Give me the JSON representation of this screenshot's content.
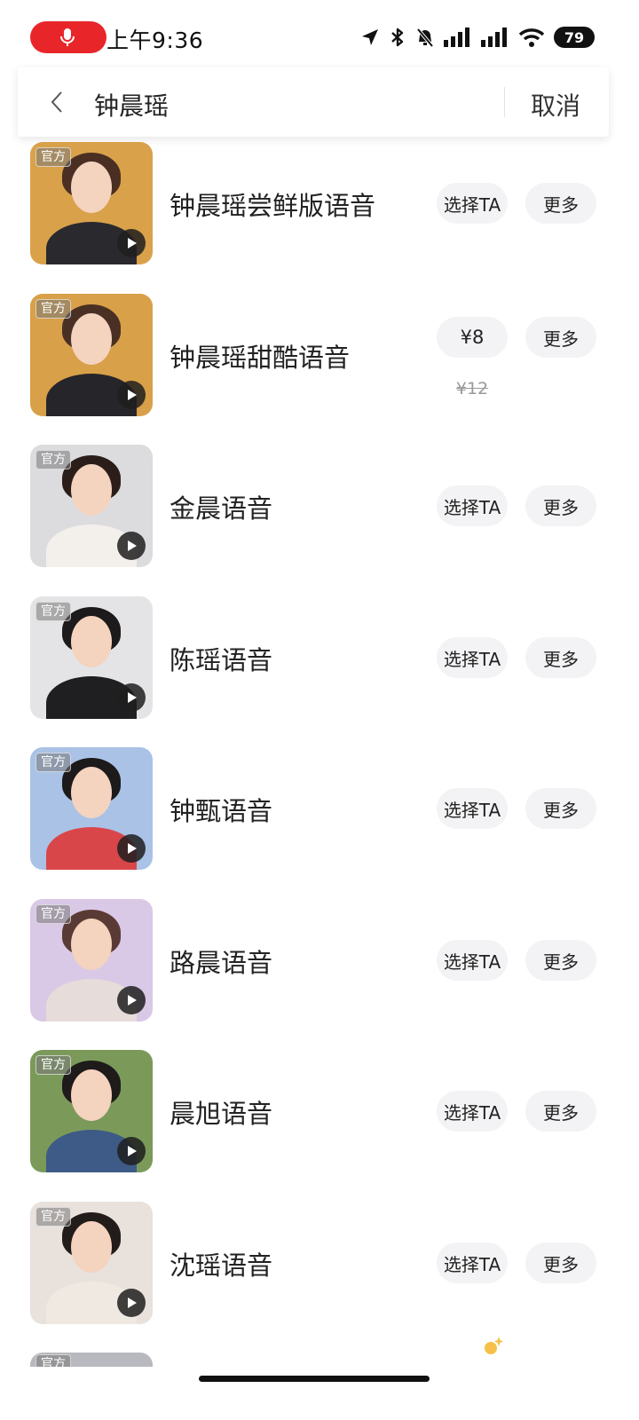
{
  "status_bar": {
    "time": "上午9:36",
    "battery": "79"
  },
  "search": {
    "query": "钟晨瑶",
    "cancel_label": "取消"
  },
  "tag_label": "官方",
  "results": [
    {
      "name": "钟晨瑶尝鲜版语音",
      "action": "选择TA",
      "more": "更多",
      "price_old": "",
      "bg": "#d9a24a",
      "hair": "#4a2f22",
      "body": "#2a2a2e"
    },
    {
      "name": "钟晨瑶甜酷语音",
      "action": "¥8",
      "more": "更多",
      "price_old": "¥12",
      "bg": "#d8a048",
      "hair": "#4a3024",
      "body": "#26262a"
    },
    {
      "name": "金晨语音",
      "action": "选择TA",
      "more": "更多",
      "price_old": "",
      "bg": "#dcdcdf",
      "hair": "#2b1e1a",
      "body": "#f3f0ec"
    },
    {
      "name": "陈瑶语音",
      "action": "选择TA",
      "more": "更多",
      "price_old": "",
      "bg": "#e4e4e6",
      "hair": "#1c1a1a",
      "body": "#1f1f22"
    },
    {
      "name": "钟甄语音",
      "action": "选择TA",
      "more": "更多",
      "price_old": "",
      "bg": "#a9c2e6",
      "hair": "#1c1a1a",
      "body": "#d9464a"
    },
    {
      "name": "路晨语音",
      "action": "选择TA",
      "more": "更多",
      "price_old": "",
      "bg": "#d9c8e6",
      "hair": "#5a3a34",
      "body": "#e6dcda"
    },
    {
      "name": "晨旭语音",
      "action": "选择TA",
      "more": "更多",
      "price_old": "",
      "bg": "#7b9a5a",
      "hair": "#1e1b1a",
      "body": "#3e5a86"
    },
    {
      "name": "沈瑶语音",
      "action": "选择TA",
      "more": "更多",
      "price_old": "",
      "bg": "#e8e1dc",
      "hair": "#221c1a",
      "body": "#efe9e2"
    }
  ]
}
